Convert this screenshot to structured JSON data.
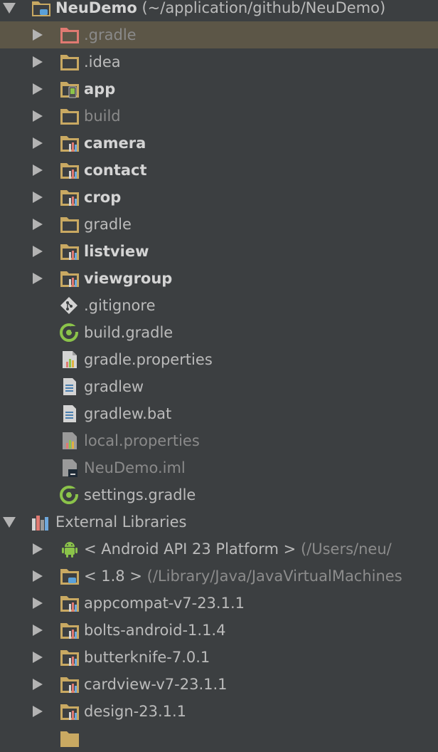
{
  "root": {
    "name": "NeuDemo",
    "path": "(~/application/github/NeuDemo)"
  },
  "items": [
    {
      "label": ".gradle"
    },
    {
      "label": ".idea"
    },
    {
      "label": "app"
    },
    {
      "label": "build"
    },
    {
      "label": "camera"
    },
    {
      "label": "contact"
    },
    {
      "label": "crop"
    },
    {
      "label": "gradle"
    },
    {
      "label": "listview"
    },
    {
      "label": "viewgroup"
    },
    {
      "label": ".gitignore"
    },
    {
      "label": "build.gradle"
    },
    {
      "label": "gradle.properties"
    },
    {
      "label": "gradlew"
    },
    {
      "label": "gradlew.bat"
    },
    {
      "label": "local.properties"
    },
    {
      "label": "NeuDemo.iml"
    },
    {
      "label": "settings.gradle"
    }
  ],
  "external": {
    "label": "External Libraries",
    "items": [
      {
        "label": "< Android API 23 Platform >",
        "extra": "(/Users/neu/"
      },
      {
        "label": "< 1.8 >",
        "extra": "(/Library/Java/JavaVirtualMachines"
      },
      {
        "label": "appcompat-v7-23.1.1"
      },
      {
        "label": "bolts-android-1.1.4"
      },
      {
        "label": "butterknife-7.0.1"
      },
      {
        "label": "cardview-v7-23.1.1"
      },
      {
        "label": "design-23.1.1"
      }
    ]
  }
}
